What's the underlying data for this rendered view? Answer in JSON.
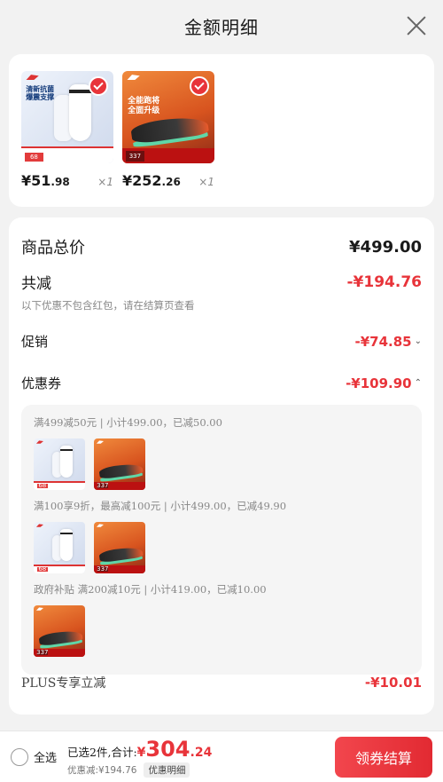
{
  "header": {
    "title": "金额明细"
  },
  "products": [
    {
      "price_int": "¥51",
      "price_dec": ".98",
      "qty": "×1",
      "image": "sock",
      "img_text": "清新抗菌\n爆震支撑",
      "tag": "68",
      "selected": true
    },
    {
      "price_int": "¥252",
      "price_dec": ".26",
      "qty": "×1",
      "image": "shoe",
      "img_text": "全能跑将\n全面升级",
      "tag": "337",
      "selected": true
    }
  ],
  "summary": {
    "total_label": "商品总价",
    "total_value": "¥499.00",
    "discount_label": "共减",
    "discount_value": "-¥194.76",
    "note": "以下优惠不包含红包，请在结算页查看",
    "promo_label": "促销",
    "promo_value": "-¥74.85",
    "coupon_label": "优惠券",
    "coupon_value": "-¥109.90"
  },
  "coupons": [
    {
      "title": "满499减50元 | 小计499.00，已减50.00",
      "images": [
        "sock",
        "shoe"
      ]
    },
    {
      "title": "满100享9折，最高减100元 | 小计499.00，已减49.90",
      "images": [
        "sock",
        "shoe"
      ]
    },
    {
      "title": "政府补贴 满200减10元 | 小计419.00，已减10.00",
      "images": [
        "shoe"
      ]
    }
  ],
  "plus": {
    "label": "PLUS专享立减",
    "value": "-¥10.01"
  },
  "footer": {
    "select_all": "全选",
    "selected_text": "已选2件,合计:",
    "price_sym": "¥",
    "price_int": "304",
    "price_dec": ".24",
    "discount_text": "优惠减:¥194.76",
    "detail_label": "优惠明细",
    "checkout_label": "领券结算"
  },
  "colors": {
    "accent": "#e8343a",
    "background": "#f2f2f2"
  }
}
